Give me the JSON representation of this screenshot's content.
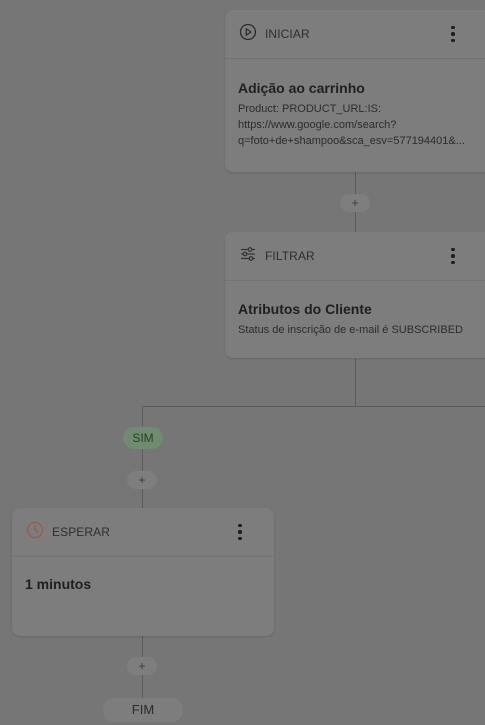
{
  "nodes": {
    "start": {
      "type_label": "INICIAR",
      "title": "Adição ao carrinho",
      "desc_line1": "Product: PRODUCT_URL:IS:",
      "desc_line2": "https://www.google.com/search?",
      "desc_line3": "q=foto+de+shampoo&sca_esv=577194401&..."
    },
    "filter": {
      "type_label": "FILTRAR",
      "title": "Atributos do Cliente",
      "desc": "Status de inscrição de e-mail é SUBSCRIBED"
    },
    "wait": {
      "type_label": "ESPERAR",
      "title": "1 minutos"
    }
  },
  "branch": {
    "yes_label": "SIM"
  },
  "end": {
    "label": "FIM"
  },
  "add_step_label": "+",
  "colors": {
    "overlay_background": "#767676",
    "yes_badge": "#6f8c6f",
    "wait_icon": "#9a5a4a"
  },
  "icons": {
    "start": "play-circle-icon",
    "filter": "sliders-icon",
    "wait": "clock-icon",
    "menu": "more-vertical-icon"
  }
}
